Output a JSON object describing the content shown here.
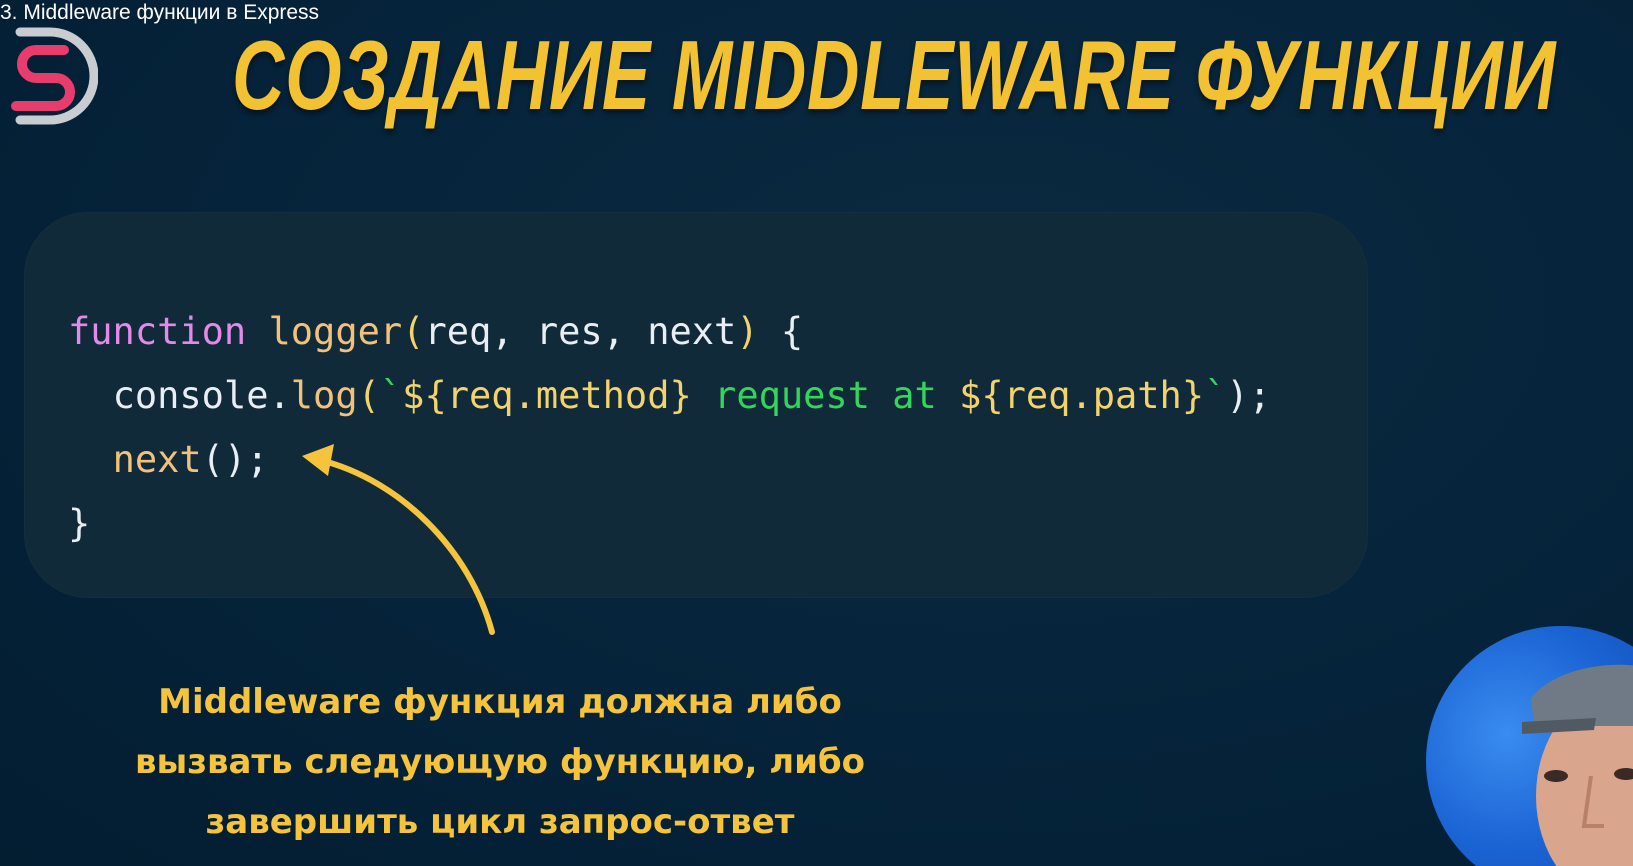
{
  "video": {
    "title": "3. Middleware функции в Express"
  },
  "slide": {
    "title": "СОЗДАНИЕ MIDDLEWARE ФУНКЦИИ",
    "code": {
      "line1": {
        "kw": "function",
        "fn": "logger",
        "open": "(",
        "args": "req, res, next",
        "close": ")",
        "brace": " {"
      },
      "line2": {
        "obj": "console.",
        "method": "log",
        "open": "(",
        "tick_open": "`",
        "interp1": "${req.method}",
        "text": " request at ",
        "interp2": "${req.path}",
        "tick_close": "`",
        "close": ");"
      },
      "line3": {
        "fn": "next",
        "rest": "();"
      },
      "line4": {
        "brace": "}"
      }
    },
    "callout": {
      "line1": "Middleware функция должна либо",
      "line2": "вызвать следующую функцию, либо",
      "line3": "завершить цикл запрос-ответ"
    }
  },
  "colors": {
    "background": "#052237",
    "panel": "#112a3a",
    "title_yellow": "#f3c232",
    "keyword": "#e38ae8",
    "function_name": "#f3c27a",
    "string": "#31d65a",
    "callout": "#f5c43c",
    "arrow": "#f5c43c"
  },
  "icons": {
    "logo": "ds-logo-icon",
    "arrow": "curved-arrow-icon",
    "presenter": "presenter-avatar"
  }
}
